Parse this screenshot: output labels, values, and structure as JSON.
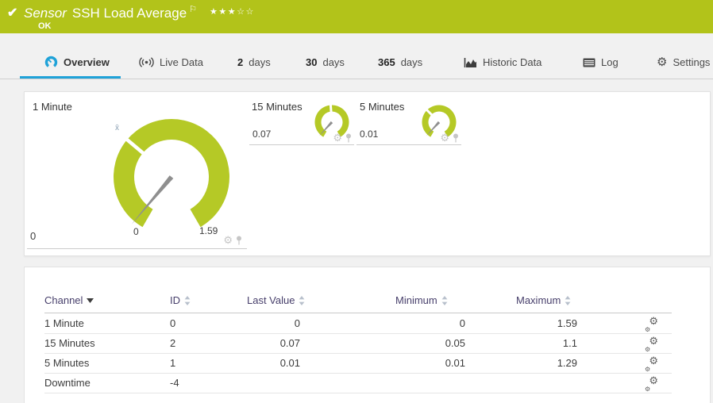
{
  "header": {
    "check": "✔",
    "kind": "Sensor",
    "title": "SSH Load Average",
    "flag": "⚐",
    "stars": "★★★☆☆",
    "status": "OK"
  },
  "tabs": [
    {
      "label": "Overview"
    },
    {
      "label": "Live Data"
    },
    {
      "num": "2",
      "rest": "days"
    },
    {
      "num": "30",
      "rest": "days"
    },
    {
      "num": "365",
      "rest": "days"
    },
    {
      "label": "Historic Data"
    },
    {
      "label": "Log"
    },
    {
      "label": "Settings"
    }
  ],
  "gauges": {
    "main": {
      "title": "1 Minute",
      "value": "0",
      "scale_min": "0",
      "scale_max": "1.59",
      "avg_marker": "x̄"
    },
    "small": [
      {
        "title": "15 Minutes",
        "value": "0.07"
      },
      {
        "title": "5 Minutes",
        "value": "0.01"
      }
    ]
  },
  "table": {
    "headers": [
      "Channel",
      "ID",
      "Last Value",
      "Minimum",
      "Maximum"
    ],
    "rows": [
      {
        "channel": "1 Minute",
        "id": "0",
        "last": "0",
        "min": "0",
        "max": "1.59"
      },
      {
        "channel": "15 Minutes",
        "id": "2",
        "last": "0.07",
        "min": "0.05",
        "max": "1.1"
      },
      {
        "channel": "5 Minutes",
        "id": "1",
        "last": "0.01",
        "min": "0.01",
        "max": "1.29"
      },
      {
        "channel": "Downtime",
        "id": "-4",
        "last": "",
        "min": "",
        "max": ""
      }
    ]
  },
  "colors": {
    "ok_green": "#b2c31a",
    "gauge_green": "#b5c926",
    "accent_blue": "#1fa2d8"
  }
}
